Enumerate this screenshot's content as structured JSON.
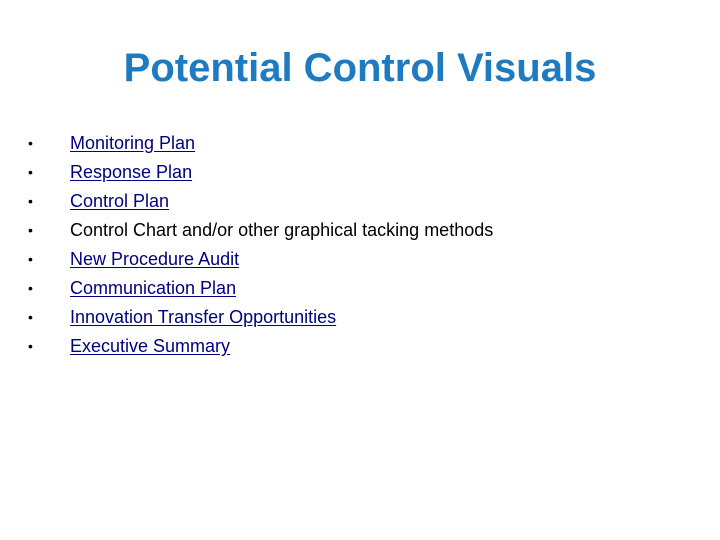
{
  "slide": {
    "title": "Potential Control Visuals",
    "colors": {
      "title": "#1f7bc1",
      "link": "#000080",
      "text": "#000000"
    },
    "bullet_glyph": "•",
    "items": [
      {
        "label": "Monitoring Plan",
        "is_link": true
      },
      {
        "label": "Response Plan",
        "is_link": true
      },
      {
        "label": "Control Plan",
        "is_link": true
      },
      {
        "label": "Control Chart and/or other graphical tacking methods",
        "is_link": false
      },
      {
        "label": "New Procedure Audit",
        "is_link": true
      },
      {
        "label": "Communication Plan",
        "is_link": true
      },
      {
        "label": "Innovation Transfer Opportunities",
        "is_link": true
      },
      {
        "label": "Executive Summary",
        "is_link": true
      }
    ]
  }
}
